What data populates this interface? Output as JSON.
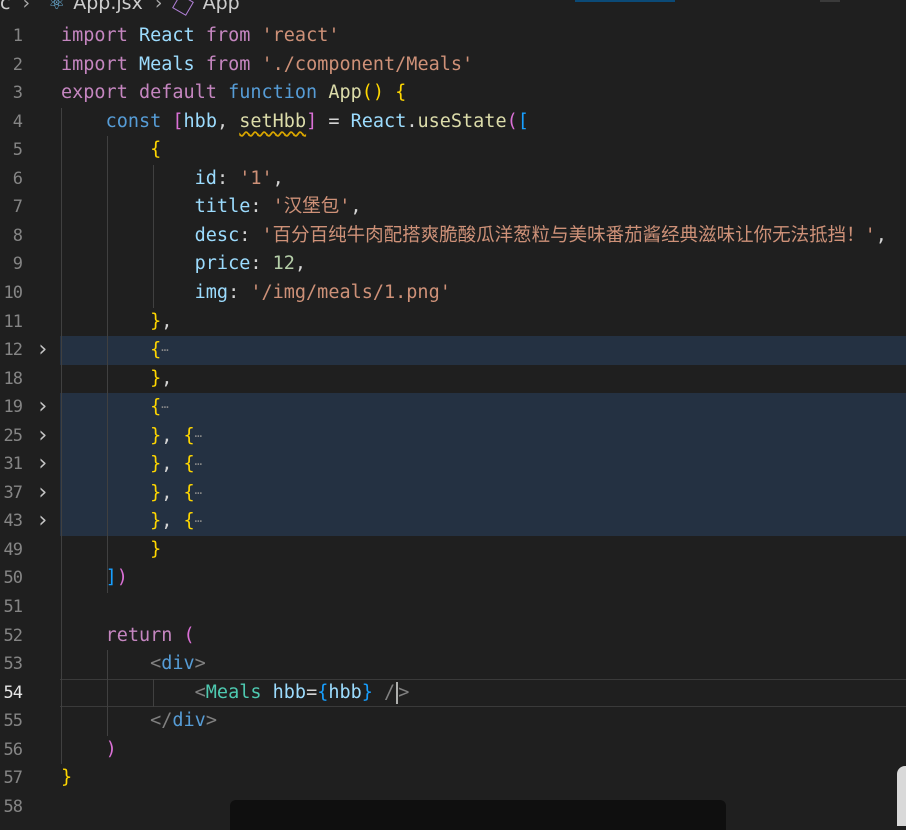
{
  "breadcrumb": {
    "prefix": "c",
    "file": "App.jsx",
    "symbol": "App"
  },
  "editor": {
    "lines": [
      {
        "n": "1",
        "tokens": [
          [
            "kw",
            "import"
          ],
          [
            "plain",
            " "
          ],
          [
            "var",
            "React"
          ],
          [
            "plain",
            " "
          ],
          [
            "kw",
            "from"
          ],
          [
            "plain",
            " "
          ],
          [
            "str",
            "'react'"
          ]
        ]
      },
      {
        "n": "2",
        "tokens": [
          [
            "kw",
            "import"
          ],
          [
            "plain",
            " "
          ],
          [
            "var",
            "Meals"
          ],
          [
            "plain",
            " "
          ],
          [
            "kw",
            "from"
          ],
          [
            "plain",
            " "
          ],
          [
            "str",
            "'./component/Meals'"
          ]
        ]
      },
      {
        "n": "3",
        "tokens": [
          [
            "kw",
            "export"
          ],
          [
            "plain",
            " "
          ],
          [
            "kw",
            "default"
          ],
          [
            "plain",
            " "
          ],
          [
            "kw2",
            "function"
          ],
          [
            "plain",
            " "
          ],
          [
            "fn",
            "App"
          ],
          [
            "br1",
            "()"
          ],
          [
            "plain",
            " "
          ],
          [
            "br1",
            "{"
          ]
        ]
      },
      {
        "n": "4",
        "tokens": [
          [
            "plain",
            "    "
          ],
          [
            "kw2",
            "const"
          ],
          [
            "plain",
            " "
          ],
          [
            "br2",
            "["
          ],
          [
            "var",
            "hbb"
          ],
          [
            "plain",
            ", "
          ],
          [
            "fn squig",
            "setHbb"
          ],
          [
            "br2",
            "]"
          ],
          [
            "plain",
            " = "
          ],
          [
            "var",
            "React"
          ],
          [
            "plain",
            "."
          ],
          [
            "fn",
            "useState"
          ],
          [
            "br2",
            "("
          ],
          [
            "br3",
            "["
          ]
        ]
      },
      {
        "n": "5",
        "tokens": [
          [
            "plain",
            "        "
          ],
          [
            "br1",
            "{"
          ]
        ]
      },
      {
        "n": "6",
        "tokens": [
          [
            "plain",
            "            "
          ],
          [
            "var",
            "id"
          ],
          [
            "plain",
            ": "
          ],
          [
            "str",
            "'1'"
          ],
          [
            "plain",
            ","
          ]
        ]
      },
      {
        "n": "7",
        "tokens": [
          [
            "plain",
            "            "
          ],
          [
            "var",
            "title"
          ],
          [
            "plain",
            ": "
          ],
          [
            "str",
            "'汉堡包'"
          ],
          [
            "plain",
            ","
          ]
        ]
      },
      {
        "n": "8",
        "tokens": [
          [
            "plain",
            "            "
          ],
          [
            "var",
            "desc"
          ],
          [
            "plain",
            ": "
          ],
          [
            "str",
            "'百分百纯牛肉配搭爽脆酸瓜洋葱粒与美味番茄酱经典滋味让你无法抵挡！'"
          ],
          [
            "plain",
            ","
          ]
        ]
      },
      {
        "n": "9",
        "tokens": [
          [
            "plain",
            "            "
          ],
          [
            "var",
            "price"
          ],
          [
            "plain",
            ": "
          ],
          [
            "num",
            "12"
          ],
          [
            "plain",
            ","
          ]
        ]
      },
      {
        "n": "10",
        "tokens": [
          [
            "plain",
            "            "
          ],
          [
            "var",
            "img"
          ],
          [
            "plain",
            ": "
          ],
          [
            "str",
            "'/img/meals/1.png'"
          ]
        ]
      },
      {
        "n": "11",
        "tokens": [
          [
            "plain",
            "        "
          ],
          [
            "br1",
            "}"
          ],
          [
            "plain",
            ","
          ]
        ]
      },
      {
        "n": "12",
        "fold": true,
        "hl": true,
        "tokens": [
          [
            "plain",
            "        "
          ],
          [
            "br1",
            "{"
          ],
          [
            "ellipsis",
            "⋯"
          ]
        ]
      },
      {
        "n": "18",
        "tokens": [
          [
            "plain",
            "        "
          ],
          [
            "br1",
            "}"
          ],
          [
            "plain",
            ","
          ]
        ]
      },
      {
        "n": "19",
        "fold": true,
        "hl": true,
        "tokens": [
          [
            "plain",
            "        "
          ],
          [
            "br1",
            "{"
          ],
          [
            "ellipsis",
            "⋯"
          ]
        ]
      },
      {
        "n": "25",
        "fold": true,
        "hl": true,
        "tokens": [
          [
            "plain",
            "        "
          ],
          [
            "br1",
            "}"
          ],
          [
            "plain",
            ", "
          ],
          [
            "br1",
            "{"
          ],
          [
            "ellipsis",
            "⋯"
          ]
        ]
      },
      {
        "n": "31",
        "fold": true,
        "hl": true,
        "tokens": [
          [
            "plain",
            "        "
          ],
          [
            "br1",
            "}"
          ],
          [
            "plain",
            ", "
          ],
          [
            "br1",
            "{"
          ],
          [
            "ellipsis",
            "⋯"
          ]
        ]
      },
      {
        "n": "37",
        "fold": true,
        "hl": true,
        "tokens": [
          [
            "plain",
            "        "
          ],
          [
            "br1",
            "}"
          ],
          [
            "plain",
            ", "
          ],
          [
            "br1",
            "{"
          ],
          [
            "ellipsis",
            "⋯"
          ]
        ]
      },
      {
        "n": "43",
        "fold": true,
        "hl": true,
        "tokens": [
          [
            "plain",
            "        "
          ],
          [
            "br1",
            "}"
          ],
          [
            "plain",
            ", "
          ],
          [
            "br1",
            "{"
          ],
          [
            "ellipsis",
            "⋯"
          ]
        ]
      },
      {
        "n": "49",
        "tokens": [
          [
            "plain",
            "        "
          ],
          [
            "br1",
            "}"
          ]
        ]
      },
      {
        "n": "50",
        "tokens": [
          [
            "plain",
            "    "
          ],
          [
            "br3",
            "]"
          ],
          [
            "br2",
            ")"
          ]
        ]
      },
      {
        "n": "51",
        "tokens": []
      },
      {
        "n": "52",
        "tokens": [
          [
            "plain",
            "    "
          ],
          [
            "kw",
            "return"
          ],
          [
            "plain",
            " "
          ],
          [
            "br2",
            "("
          ]
        ]
      },
      {
        "n": "53",
        "tokens": [
          [
            "plain",
            "        "
          ],
          [
            "punc",
            "<"
          ],
          [
            "tag",
            "div"
          ],
          [
            "punc",
            ">"
          ]
        ]
      },
      {
        "n": "54",
        "active": true,
        "tokens": [
          [
            "plain",
            "            "
          ],
          [
            "punc",
            "<"
          ],
          [
            "cls",
            "Meals"
          ],
          [
            "plain",
            " "
          ],
          [
            "var",
            "hbb"
          ],
          [
            "plain",
            "="
          ],
          [
            "br3",
            "{"
          ],
          [
            "var",
            "hbb"
          ],
          [
            "br3",
            "}"
          ],
          [
            "plain",
            " "
          ],
          [
            "punc",
            "/"
          ],
          [
            "cursor",
            ""
          ],
          [
            "punc",
            ">"
          ]
        ]
      },
      {
        "n": "55",
        "tokens": [
          [
            "plain",
            "        "
          ],
          [
            "punc",
            "</"
          ],
          [
            "tag",
            "div"
          ],
          [
            "punc",
            ">"
          ]
        ]
      },
      {
        "n": "56",
        "tokens": [
          [
            "plain",
            "    "
          ],
          [
            "br2",
            ")"
          ]
        ]
      },
      {
        "n": "57",
        "tokens": [
          [
            "br1",
            "}"
          ]
        ]
      },
      {
        "n": "58",
        "tokens": []
      }
    ]
  }
}
